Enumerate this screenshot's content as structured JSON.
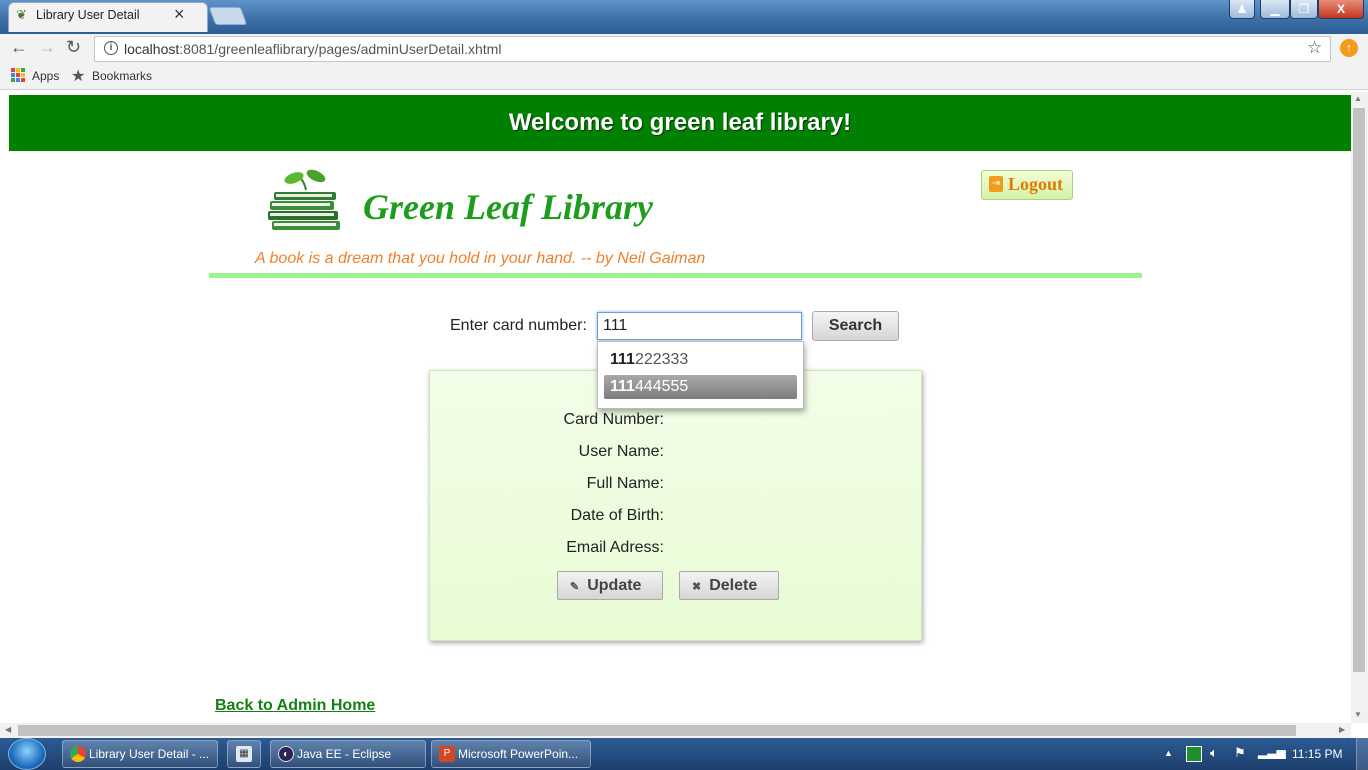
{
  "browser": {
    "tab_title": "Library User Detail",
    "url_host": "localhost",
    "url_path": ":8081/greenleaflibrary/pages/adminUserDetail.xhtml",
    "bookmarks_bar": {
      "apps_label": "Apps",
      "bookmarks_label": "Bookmarks"
    }
  },
  "page": {
    "banner": "Welcome to green leaf library!",
    "brand_name": "Green Leaf Library",
    "logout_label": "Logout",
    "quote": "A book is a dream that you hold in your hand. -- by Neil Gaiman",
    "search": {
      "label": "Enter card number:",
      "value": "111",
      "button_label": "Search",
      "suggestions": [
        {
          "match": "111",
          "rest": "222333",
          "highlighted": false
        },
        {
          "match": "111",
          "rest": "444555",
          "highlighted": true
        }
      ]
    },
    "detail_fields": [
      "Card Number:",
      "User Name:",
      "Full Name:",
      "Date of Birth:",
      "Email Adress:"
    ],
    "actions": {
      "update_label": "Update",
      "delete_label": "Delete"
    },
    "back_link": "Back to Admin Home"
  },
  "colors": {
    "banner_bg": "#008000",
    "brand_text": "#1d9d1d",
    "quote_text": "#f07f2a",
    "divider": "#9cf491",
    "panel_bg": "#e9fbd8"
  },
  "taskbar": {
    "items": [
      {
        "label": "Library User Detail - ...",
        "icon": "chrome-icon"
      },
      {
        "label": "",
        "icon": "calculator-icon"
      },
      {
        "label": "Java EE - Eclipse",
        "icon": "eclipse-icon"
      },
      {
        "label": "Microsoft PowerPoin...",
        "icon": "powerpoint-icon"
      }
    ],
    "clock": "11:15 PM"
  }
}
